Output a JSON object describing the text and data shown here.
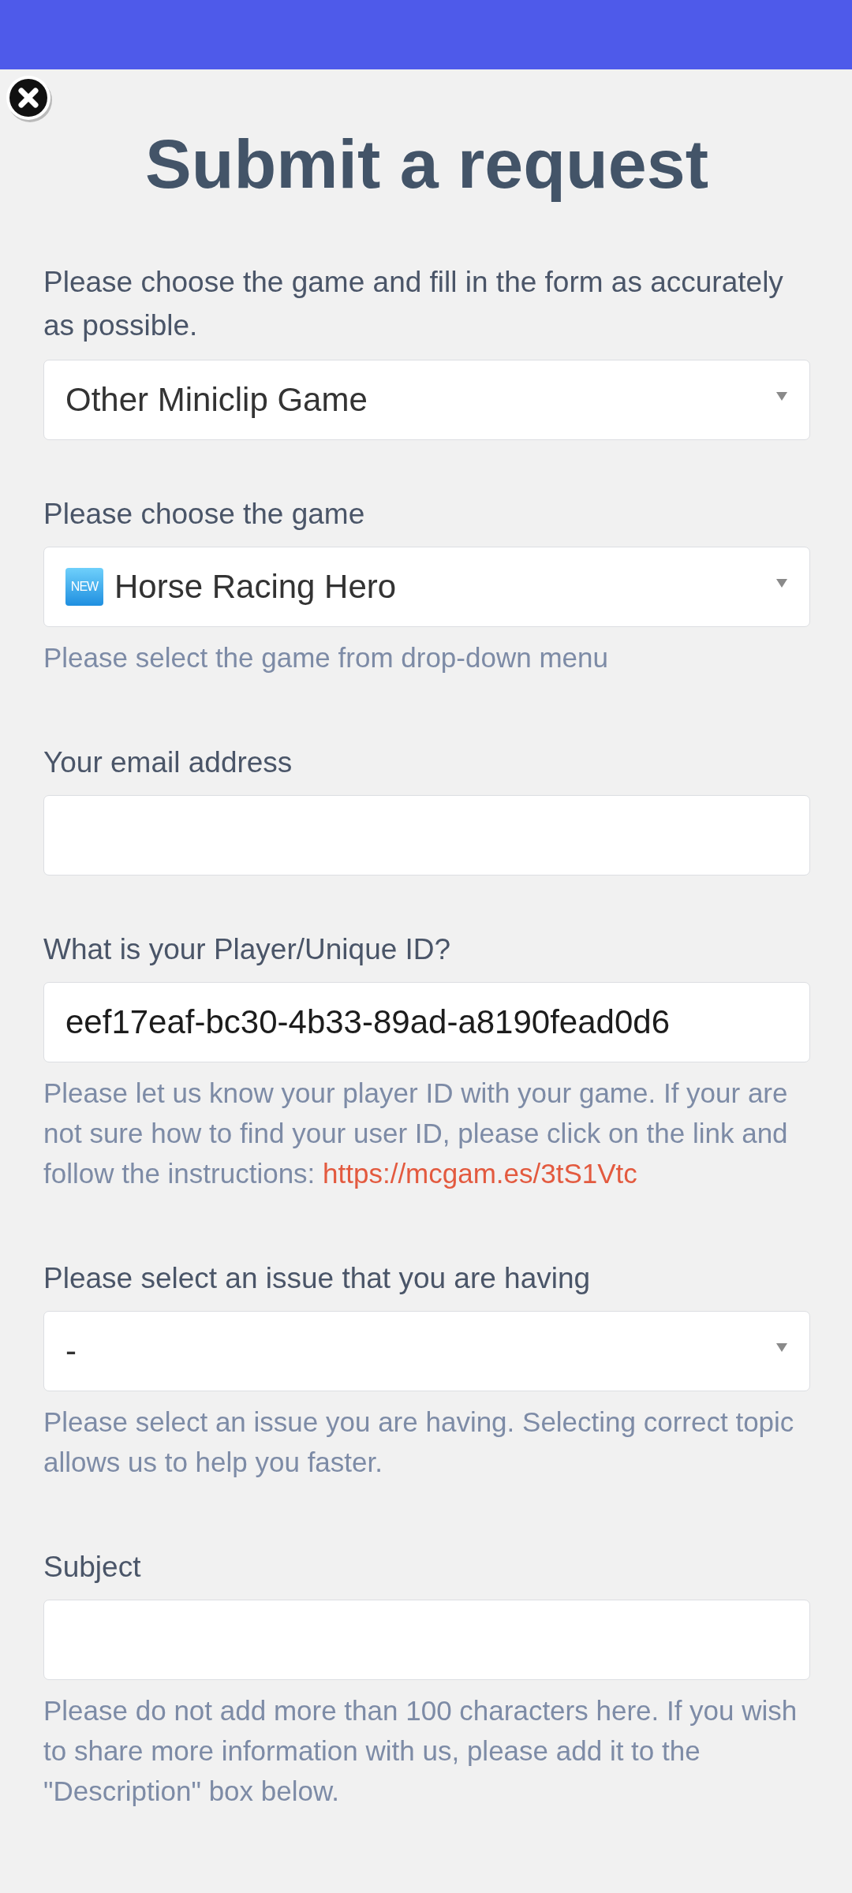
{
  "title": "Submit a request",
  "intro": "Please choose the game and fill in the form as accurately as possible.",
  "fields": [
    {
      "kind": "select",
      "value": "Other Miniclip Game"
    },
    {
      "kind": "select",
      "label": "Please choose the game",
      "badge": "NEW",
      "value": "Horse Racing Hero",
      "hint": "Please select the game from drop-down menu"
    },
    {
      "kind": "text",
      "label": "Your email address"
    },
    {
      "kind": "text",
      "label": "What is your Player/Unique ID?",
      "value": "eef17eaf-bc30-4b33-89ad-a8190fead0d6",
      "hint": "Please let us know your player ID with your game. If your are not sure how to find your user ID, please click on the link and follow the instructions:",
      "link": "https://mcgam.es/3tS1Vtc"
    },
    {
      "kind": "select",
      "label": "Please select an issue that you are having",
      "value": "-",
      "hint": "Please select an issue you are having. Selecting correct topic allows us to help you faster."
    },
    {
      "kind": "text",
      "label": "Subject",
      "hint": "Please do not add more than 100 characters here. If you wish to share more information with us, please add it to the \"Description\" box below."
    }
  ]
}
